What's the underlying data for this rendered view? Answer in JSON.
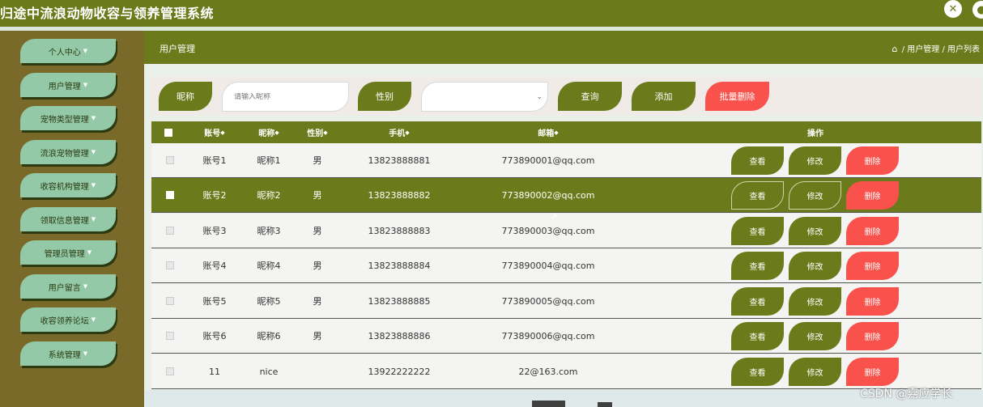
{
  "app": {
    "title": "归途中流浪动物收容与领养管理系统",
    "expand_icon": "expand-icon",
    "user_icon": "user-icon"
  },
  "sidebar": {
    "items": [
      {
        "label": "个人中心"
      },
      {
        "label": "用户管理"
      },
      {
        "label": "宠物类型管理"
      },
      {
        "label": "流浪宠物管理"
      },
      {
        "label": "收容机构管理"
      },
      {
        "label": "领取信息管理"
      },
      {
        "label": "管理员管理"
      },
      {
        "label": "用户留言"
      },
      {
        "label": "收容领养论坛"
      },
      {
        "label": "系统管理"
      }
    ]
  },
  "page": {
    "title": "用户管理",
    "breadcrumb": [
      "用户管理",
      "用户列表"
    ]
  },
  "search": {
    "nickname_label": "昵称",
    "nickname_placeholder": "请输入昵称",
    "nickname_value": "",
    "gender_label": "性别",
    "gender_value": "",
    "query_label": "查询",
    "add_label": "添加",
    "batch_delete_label": "批量删除"
  },
  "table": {
    "columns": {
      "account": "账号",
      "nickname": "昵称",
      "gender": "性别",
      "phone": "手机",
      "email": "邮箱",
      "actions": "操作"
    },
    "sort_indicator": "◆",
    "action_labels": {
      "view": "查看",
      "edit": "修改",
      "delete": "删除"
    },
    "rows": [
      {
        "account": "账号1",
        "nickname": "昵称1",
        "gender": "男",
        "phone": "13823888881",
        "email": "773890001@qq.com"
      },
      {
        "account": "账号2",
        "nickname": "昵称2",
        "gender": "男",
        "phone": "13823888882",
        "email": "773890002@qq.com"
      },
      {
        "account": "账号3",
        "nickname": "昵称3",
        "gender": "男",
        "phone": "13823888883",
        "email": "773890003@qq.com"
      },
      {
        "account": "账号4",
        "nickname": "昵称4",
        "gender": "男",
        "phone": "13823888884",
        "email": "773890004@qq.com"
      },
      {
        "account": "账号5",
        "nickname": "昵称5",
        "gender": "男",
        "phone": "13823888885",
        "email": "773890005@qq.com"
      },
      {
        "account": "账号6",
        "nickname": "昵称6",
        "gender": "男",
        "phone": "13823888886",
        "email": "773890006@qq.com"
      },
      {
        "account": "11",
        "nickname": "nice",
        "gender": "",
        "phone": "13922222222",
        "email": "22@163.com"
      }
    ],
    "highlighted_row": 1
  },
  "watermark": "CSDN @嘉应学长",
  "colors": {
    "primary": "#6b7a1a",
    "sidebar_bg": "#7a6a2a",
    "sidebar_item": "#93c9a6",
    "danger": "#f9514b"
  }
}
